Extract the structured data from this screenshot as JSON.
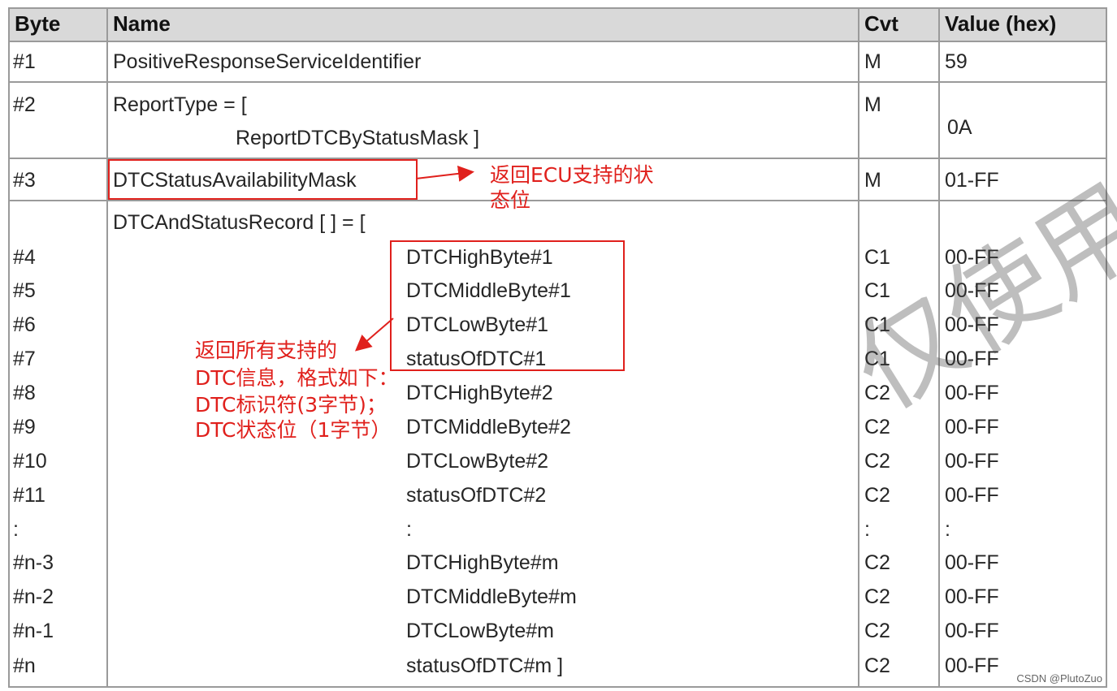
{
  "header": {
    "byte": "Byte",
    "name": "Name",
    "cvt": "Cvt",
    "value": "Value (hex)"
  },
  "rows": [
    {
      "byte": "#1",
      "name": "PositiveResponseServiceIdentifier",
      "cvt": "M",
      "value": "59"
    },
    {
      "byte": "#2",
      "name": "ReportType = [",
      "name2": "ReportDTCByStatusMask ]",
      "cvt": "M",
      "value": "0A"
    },
    {
      "byte": "#3",
      "name": "DTCStatusAvailabilityMask",
      "cvt": "M",
      "value": "01-FF"
    }
  ],
  "record": {
    "title": "DTCAndStatusRecord [ ] = [",
    "lines": [
      {
        "byte": "#4",
        "name": "DTCHighByte#1",
        "cvt": "C1",
        "value": "00-FF"
      },
      {
        "byte": "#5",
        "name": "DTCMiddleByte#1",
        "cvt": "C1",
        "value": "00-FF"
      },
      {
        "byte": "#6",
        "name": "DTCLowByte#1",
        "cvt": "C1",
        "value": "00-FF"
      },
      {
        "byte": "#7",
        "name": "statusOfDTC#1",
        "cvt": "C1",
        "value": "00-FF"
      },
      {
        "byte": "#8",
        "name": "DTCHighByte#2",
        "cvt": "C2",
        "value": "00-FF"
      },
      {
        "byte": "#9",
        "name": "DTCMiddleByte#2",
        "cvt": "C2",
        "value": "00-FF"
      },
      {
        "byte": "#10",
        "name": "DTCLowByte#2",
        "cvt": "C2",
        "value": "00-FF"
      },
      {
        "byte": "#11",
        "name": "statusOfDTC#2",
        "cvt": "C2",
        "value": "00-FF"
      },
      {
        "byte": ":",
        "name": ":",
        "cvt": ":",
        "value": ":"
      },
      {
        "byte": "#n-3",
        "name": "DTCHighByte#m",
        "cvt": "C2",
        "value": "00-FF"
      },
      {
        "byte": "#n-2",
        "name": "DTCMiddleByte#m",
        "cvt": "C2",
        "value": "00-FF"
      },
      {
        "byte": "#n-1",
        "name": "DTCLowByte#m",
        "cvt": "C2",
        "value": "00-FF"
      },
      {
        "byte": "#n",
        "name": "statusOfDTC#m ]",
        "cvt": "C2",
        "value": "00-FF"
      }
    ]
  },
  "annotations": {
    "ecu_note": [
      "返回ECU支持的状",
      "态位"
    ],
    "dtc_note": [
      "返回所有支持的",
      "DTC信息，格式如下：",
      "DTC标识符(3字节)；",
      "DTC状态位（1字节）"
    ],
    "red_color": "#e0201c"
  },
  "watermark": "仅使用",
  "credit": "CSDN @PlutoZuo"
}
